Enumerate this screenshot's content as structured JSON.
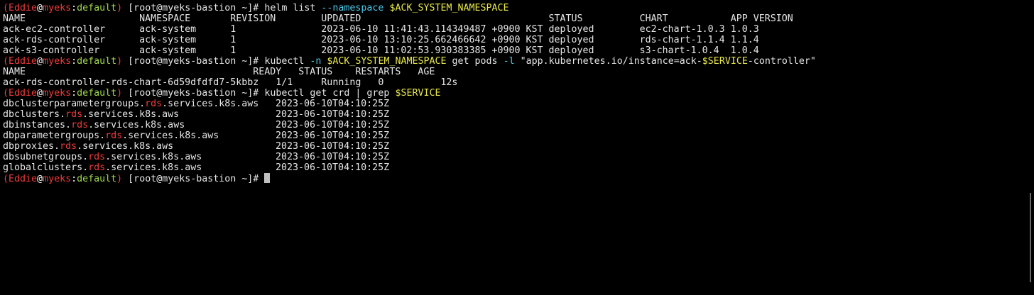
{
  "prompt": {
    "open_paren": "(",
    "user": "Eddie",
    "at": "@",
    "cluster": "myeks",
    "colon": ":",
    "namespace": "default",
    "close_paren": ")",
    "host": " [root@myeks-bastion ~]# "
  },
  "cmd1": {
    "base": "helm list ",
    "flag": "--namespace ",
    "var": "$ACK_SYSTEM_NAMESPACE"
  },
  "helm_table": {
    "header": "NAME                    NAMESPACE       REVISION        UPDATED                                 STATUS          CHART           APP VERSION",
    "rows": [
      "ack-ec2-controller      ack-system      1               2023-06-10 11:41:43.114349487 +0900 KST deployed        ec2-chart-1.0.3 1.0.3",
      "ack-rds-controller      ack-system      1               2023-06-10 13:10:25.662466642 +0900 KST deployed        rds-chart-1.1.4 1.1.4",
      "ack-s3-controller       ack-system      1               2023-06-10 11:02:53.930383385 +0900 KST deployed        s3-chart-1.0.4  1.0.4"
    ]
  },
  "cmd2": {
    "base": "kubectl ",
    "flag_n": "-n ",
    "var_ns": "$ACK_SYSTEM_NAMESPACE",
    "mid": " get pods ",
    "flag_l": "-l ",
    "str_a": "\"app.kubernetes.io/instance=ack-",
    "var_svc": "$SERVICE",
    "str_b": "-controller\""
  },
  "pods_table": {
    "header": "NAME                                        READY   STATUS    RESTARTS   AGE",
    "row": "ack-rds-controller-rds-chart-6d59dfdfd7-5kbbz   1/1     Running   0          12s"
  },
  "cmd3": {
    "base": "kubectl get crd | grep ",
    "var": "$SERVICE"
  },
  "crd_list": [
    {
      "pre": "dbclusterparametergroups.",
      "match": "rds",
      "post": ".services.k8s.aws",
      "date": "2023-06-10T04:10:25Z"
    },
    {
      "pre": "dbclusters.",
      "match": "rds",
      "post": ".services.k8s.aws",
      "date": "2023-06-10T04:10:25Z"
    },
    {
      "pre": "dbinstances.",
      "match": "rds",
      "post": ".services.k8s.aws",
      "date": "2023-06-10T04:10:25Z"
    },
    {
      "pre": "dbparametergroups.",
      "match": "rds",
      "post": ".services.k8s.aws",
      "date": "2023-06-10T04:10:25Z"
    },
    {
      "pre": "dbproxies.",
      "match": "rds",
      "post": ".services.k8s.aws",
      "date": "2023-06-10T04:10:25Z"
    },
    {
      "pre": "dbsubnetgroups.",
      "match": "rds",
      "post": ".services.k8s.aws",
      "date": "2023-06-10T04:10:25Z"
    },
    {
      "pre": "globalclusters.",
      "match": "rds",
      "post": ".services.k8s.aws",
      "date": "2023-06-10T04:10:25Z"
    }
  ],
  "colors": {
    "background": "#000000",
    "text": "#e6e6e6",
    "prompt_red": "#ef3b3b",
    "prompt_green": "#a3d94a",
    "var_yellow": "#e8e84a",
    "flag_cyan": "#4cc7e8"
  }
}
